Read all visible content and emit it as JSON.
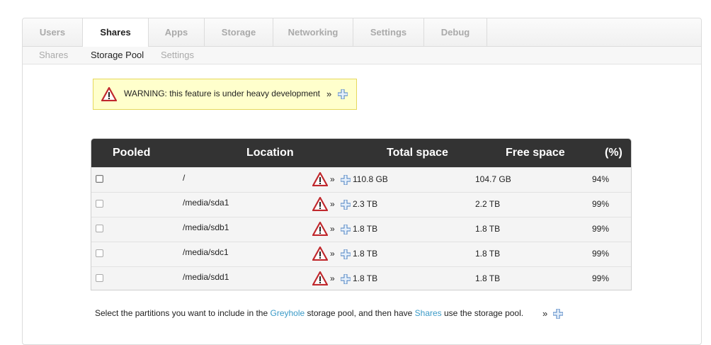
{
  "tabs": [
    {
      "label": "Users"
    },
    {
      "label": "Shares"
    },
    {
      "label": "Apps"
    },
    {
      "label": "Storage"
    },
    {
      "label": "Networking"
    },
    {
      "label": "Settings"
    },
    {
      "label": "Debug"
    }
  ],
  "subtabs": [
    {
      "label": "Shares"
    },
    {
      "label": "Storage Pool"
    },
    {
      "label": "Settings"
    }
  ],
  "warning": {
    "text": "WARNING: this feature is under heavy development",
    "raquo": "»"
  },
  "table": {
    "headers": {
      "pooled": "Pooled",
      "location": "Location",
      "total": "Total space",
      "free": "Free space",
      "pct": "(%)"
    },
    "rows": [
      {
        "location": "/",
        "total": "110.8 GB",
        "free": "104.7 GB",
        "pct": "94%"
      },
      {
        "location": "/media/sda1",
        "total": "2.3 TB",
        "free": "2.2 TB",
        "pct": "99%"
      },
      {
        "location": "/media/sdb1",
        "total": "1.8 TB",
        "free": "1.8 TB",
        "pct": "99%"
      },
      {
        "location": "/media/sdc1",
        "total": "1.8 TB",
        "free": "1.8 TB",
        "pct": "99%"
      },
      {
        "location": "/media/sdd1",
        "total": "1.8 TB",
        "free": "1.8 TB",
        "pct": "99%"
      }
    ],
    "raquo": "»"
  },
  "footer": {
    "part1": "Select the partitions you want to include in the ",
    "link1": "Greyhole",
    "part2": " storage pool, and then have ",
    "link2": "Shares",
    "part3": " use the storage pool.",
    "raquo": "»"
  },
  "colors": {
    "link": "#3a9ac7",
    "warning_bg": "#ffffcc",
    "header_bg": "#333333",
    "warn_red": "#c0282d"
  }
}
